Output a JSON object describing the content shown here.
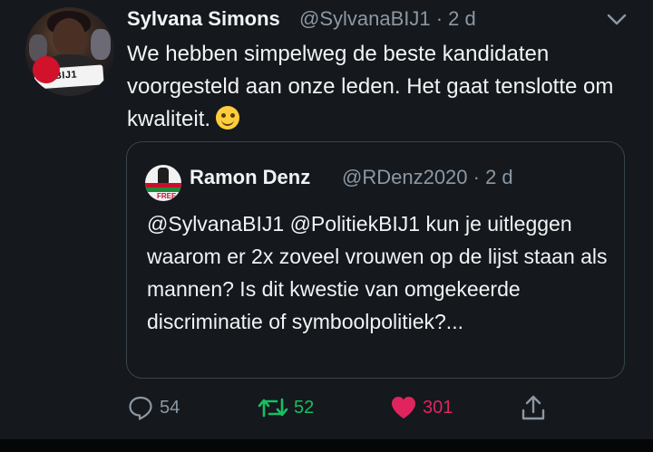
{
  "tweet": {
    "author_name": "Sylvana Simons",
    "author_handle_time": "@SylvanaBIJ1 · 2 d",
    "avatar_sign_text": "BIJ1",
    "text": "We hebben simpelweg de beste kandidaten voorgesteld aan onze leden. Het gaat tenslotte om kwaliteit.",
    "emoji": "smiling-face-emoji"
  },
  "quote": {
    "author_name": "Ramon Denz",
    "author_handle_time": "@RDenz2020 · 2 d",
    "avatar_text": "FREE",
    "text": "@SylvanaBIJ1 @PolitiekBIJ1 kun je uitleggen waarom er 2x zoveel vrouwen op de lijst staan als mannen? Is dit kwestie van omgekeerde discriminatie of symboolpolitiek?..."
  },
  "actions": {
    "reply_count": "54",
    "retweet_count": "52",
    "like_count": "301"
  },
  "colors": {
    "background": "#15181c",
    "retweet": "#17bf63",
    "like": "#e0245e",
    "muted": "#8b98a5"
  }
}
